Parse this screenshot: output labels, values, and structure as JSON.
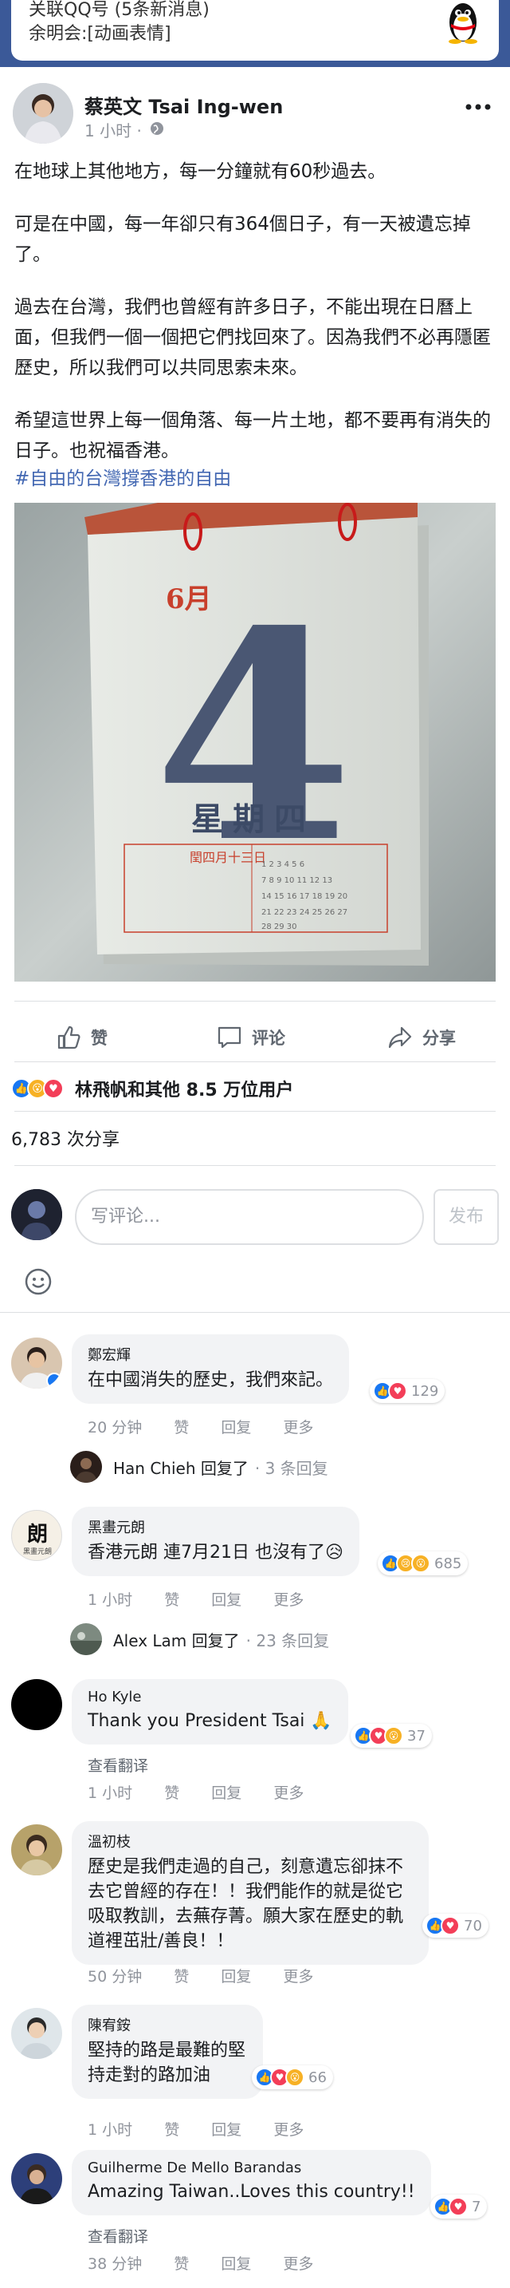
{
  "notification": {
    "title": "关联QQ号 (5条新消息)",
    "message": "余明会:[动画表情]",
    "icon": "qq-penguin-icon"
  },
  "post": {
    "author": "蔡英文 Tsai Ing-wen",
    "time": "1 小时 ·",
    "paragraphs": [
      "在地球上其他地方，每一分鐘就有60秒過去。",
      "可是在中國，每一年卻只有364個日子，有一天被遺忘掉了。",
      "過去在台灣，我們也曾經有許多日子，不能出現在日曆上面，但我們一個一個把它們找回來了。因為我們不必再隱匿歷史，所以我們可以共同思索未來。",
      "希望這世界上每一個角落、每一片土地，都不要再有消失的日子。也祝福香港。"
    ],
    "hashtag": "#自由的台灣撐香港的自由",
    "calendar": {
      "month": "6月",
      "day": "4",
      "weekday": "星期四",
      "lunar": "閏四月十三日"
    }
  },
  "actions": {
    "like": "赞",
    "comment": "评论",
    "share": "分享"
  },
  "reactions_summary": "林飛帆和其他 8.5 万位用户",
  "share_count": "6,783 次分享",
  "composer": {
    "placeholder": "写评论...",
    "publish": "发布"
  },
  "meta_labels": {
    "like": "赞",
    "reply": "回复",
    "more": "更多",
    "translate": "查看翻译"
  },
  "comments": [
    {
      "name": "鄭宏輝",
      "text": "在中國消失的歷史，我們來記。",
      "time": "20 分钟",
      "react_count": "129"
    },
    {
      "name": "黑畫元朗",
      "text": "香港元朗 連7月21日 也沒有了😥",
      "time": "1 小时",
      "react_count": "685"
    },
    {
      "name": "Ho Kyle",
      "text": "Thank you President Tsai 🙏",
      "time": "1 小时",
      "react_count": "37"
    },
    {
      "name": "溫初枝",
      "text": "歷史是我們走過的自己，刻意遺忘卻抹不去它曾經的存在！！我們能作的就是從它吸取教訓，去蕪存菁。願大家在歷史的軌道裡茁壯/善良！！",
      "time": "50 分钟",
      "react_count": "70"
    },
    {
      "name": "陳宥銨",
      "text": "堅持的路是最難的堅持走對的路加油",
      "time": "1 小时",
      "react_count": "66"
    },
    {
      "name": "Guilherme De Mello Barandas",
      "text": "Amazing Taiwan..Loves this country!!",
      "time": "38 分钟",
      "react_count": "7"
    }
  ],
  "replies": [
    {
      "name": "Han Chieh 回复了",
      "count": "· 3 条回复"
    },
    {
      "name": "Alex Lam 回复了",
      "count": "· 23 条回复"
    }
  ],
  "avatar_labels": {
    "comment2": "黑畫元朗"
  },
  "colors": {
    "facebook_blue": "#3b5998",
    "link_blue": "#4267b2",
    "like_blue": "#1877f2",
    "love_red": "#f33e58",
    "haha_yellow": "#f7b125",
    "calendar_number": "#4a5773"
  }
}
